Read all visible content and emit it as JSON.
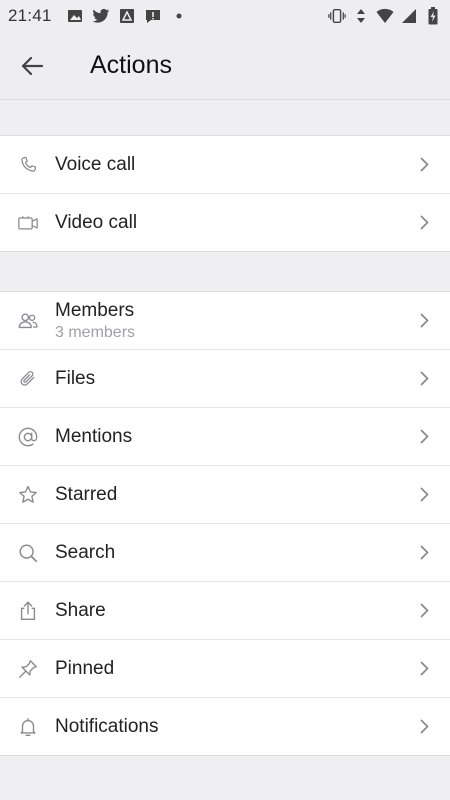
{
  "status_bar": {
    "time": "21:41",
    "left_icons": [
      "image-icon",
      "twitter-icon",
      "drive-icon",
      "alert-icon",
      "dot-icon"
    ],
    "right_icons": [
      "vibrate-icon",
      "data-arrows-icon",
      "wifi-icon",
      "signal-icon",
      "battery-charging-icon"
    ]
  },
  "header": {
    "title": "Actions",
    "back_icon": "arrow-left-icon"
  },
  "sections": [
    {
      "items": [
        {
          "label": "Voice call",
          "icon": "phone-icon"
        },
        {
          "label": "Video call",
          "icon": "video-camera-icon"
        }
      ]
    },
    {
      "items": [
        {
          "label": "Members",
          "subtitle": "3 members",
          "icon": "members-icon"
        },
        {
          "label": "Files",
          "icon": "paperclip-icon"
        },
        {
          "label": "Mentions",
          "icon": "at-icon"
        },
        {
          "label": "Starred",
          "icon": "star-icon"
        },
        {
          "label": "Search",
          "icon": "search-icon"
        },
        {
          "label": "Share",
          "icon": "share-icon"
        },
        {
          "label": "Pinned",
          "icon": "pin-icon"
        },
        {
          "label": "Notifications",
          "icon": "bell-icon"
        }
      ]
    }
  ],
  "colors": {
    "background": "#efeff1",
    "row_background": "#ffffff",
    "icon_gray": "#8a8a90",
    "text": "#222222",
    "subtext": "#a0a0a6"
  }
}
